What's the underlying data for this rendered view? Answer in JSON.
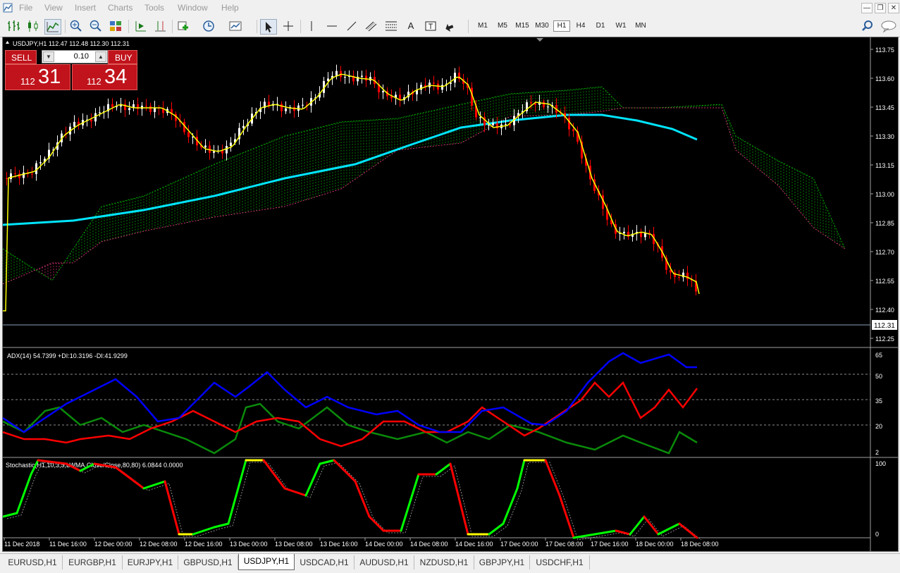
{
  "menu": {
    "items": [
      "File",
      "View",
      "Insert",
      "Charts",
      "Tools",
      "Window",
      "Help"
    ]
  },
  "toolbar": {
    "timeframes": [
      "M1",
      "M5",
      "M15",
      "M30",
      "H1",
      "H4",
      "D1",
      "W1",
      "MN"
    ],
    "active_timeframe": "H1",
    "text_tool_label": "A"
  },
  "chart": {
    "symbol_info": "USDJPY,H1  112.47 112.48 112.30 112.31",
    "current_price_label": "112.31",
    "price_axis": [
      "113.75",
      "113.60",
      "113.45",
      "113.30",
      "113.15",
      "113.00",
      "112.85",
      "112.70",
      "112.55",
      "112.40",
      "112.25"
    ],
    "time_axis": [
      "11 Dec 2018",
      "11 Dec 16:00",
      "12 Dec 00:00",
      "12 Dec 08:00",
      "12 Dec 16:00",
      "13 Dec 00:00",
      "13 Dec 08:00",
      "13 Dec 16:00",
      "14 Dec 00:00",
      "14 Dec 08:00",
      "14 Dec 16:00",
      "17 Dec 00:00",
      "17 Dec 08:00",
      "17 Dec 16:00",
      "18 Dec 00:00",
      "18 Dec 08:00"
    ]
  },
  "trade_panel": {
    "sell_label": "SELL",
    "buy_label": "BUY",
    "lot_value": "0.10",
    "sell_price_small": "112",
    "sell_price_big": "31",
    "buy_price_small": "112",
    "buy_price_big": "34"
  },
  "adx": {
    "label": "ADX(14) 54.7399 +DI:10.3196 -DI:41.9299",
    "axis": [
      "65",
      "50",
      "35",
      "20",
      "2"
    ]
  },
  "stoch": {
    "label": "Stochastic(H1,10,3,3,LWMA,Close/Close,80,80) 6.0844 0.0000",
    "axis": [
      "100",
      "0"
    ]
  },
  "tabs": [
    "EURUSD,H1",
    "EURGBP,H1",
    "EURJPY,H1",
    "GBPUSD,H1",
    "USDJPY,H1",
    "USDCAD,H1",
    "AUDUSD,H1",
    "NZDUSD,H1",
    "GBPJPY,H1",
    "USDCHF,H1"
  ],
  "active_tab": "USDJPY,H1",
  "colors": {
    "chart_bg": "#000000",
    "bull_candle": "#ffffff",
    "bear_candle": "#ff0000",
    "ma_fast": "#ffff00",
    "ma_slow": "#00e5ff",
    "cloud_bull": "#00cc00",
    "cloud_bear": "#ff3c8c",
    "adx_line": "#0000ff",
    "plus_di": "#0a8a0a",
    "minus_di": "#ff0000",
    "stoch_up": "#00ff00",
    "stoch_down": "#ff0000",
    "sell_button": "#c0131b"
  }
}
